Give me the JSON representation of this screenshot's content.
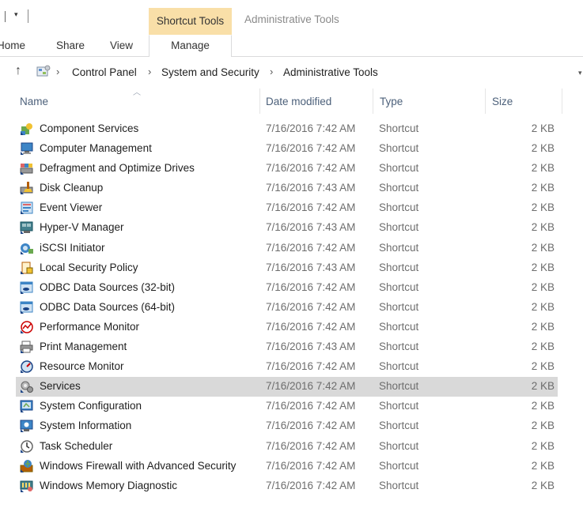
{
  "ribbon": {
    "context_tab_label": "Shortcut Tools",
    "window_title": "Administrative Tools",
    "tabs": [
      {
        "label": "Home"
      },
      {
        "label": "Share"
      },
      {
        "label": "View"
      }
    ],
    "manage_label": "Manage",
    "context_color": "#f9dfa8"
  },
  "address": {
    "crumbs": [
      "Control Panel",
      "System and Security",
      "Administrative Tools"
    ]
  },
  "columns": {
    "name": "Name",
    "date": "Date modified",
    "type": "Type",
    "size": "Size"
  },
  "files": [
    {
      "name": "Component Services",
      "date": "7/16/2016 7:42 AM",
      "type": "Shortcut",
      "size": "2 KB",
      "icon": "component-services-icon"
    },
    {
      "name": "Computer Management",
      "date": "7/16/2016 7:42 AM",
      "type": "Shortcut",
      "size": "2 KB",
      "icon": "computer-management-icon"
    },
    {
      "name": "Defragment and Optimize Drives",
      "date": "7/16/2016 7:42 AM",
      "type": "Shortcut",
      "size": "2 KB",
      "icon": "defragment-icon"
    },
    {
      "name": "Disk Cleanup",
      "date": "7/16/2016 7:43 AM",
      "type": "Shortcut",
      "size": "2 KB",
      "icon": "disk-cleanup-icon"
    },
    {
      "name": "Event Viewer",
      "date": "7/16/2016 7:42 AM",
      "type": "Shortcut",
      "size": "2 KB",
      "icon": "event-viewer-icon"
    },
    {
      "name": "Hyper-V Manager",
      "date": "7/16/2016 7:43 AM",
      "type": "Shortcut",
      "size": "2 KB",
      "icon": "hyper-v-icon"
    },
    {
      "name": "iSCSI Initiator",
      "date": "7/16/2016 7:42 AM",
      "type": "Shortcut",
      "size": "2 KB",
      "icon": "iscsi-icon"
    },
    {
      "name": "Local Security Policy",
      "date": "7/16/2016 7:43 AM",
      "type": "Shortcut",
      "size": "2 KB",
      "icon": "security-policy-icon"
    },
    {
      "name": "ODBC Data Sources (32-bit)",
      "date": "7/16/2016 7:42 AM",
      "type": "Shortcut",
      "size": "2 KB",
      "icon": "odbc-icon"
    },
    {
      "name": "ODBC Data Sources (64-bit)",
      "date": "7/16/2016 7:42 AM",
      "type": "Shortcut",
      "size": "2 KB",
      "icon": "odbc-icon"
    },
    {
      "name": "Performance Monitor",
      "date": "7/16/2016 7:42 AM",
      "type": "Shortcut",
      "size": "2 KB",
      "icon": "performance-monitor-icon"
    },
    {
      "name": "Print Management",
      "date": "7/16/2016 7:43 AM",
      "type": "Shortcut",
      "size": "2 KB",
      "icon": "print-management-icon"
    },
    {
      "name": "Resource Monitor",
      "date": "7/16/2016 7:42 AM",
      "type": "Shortcut",
      "size": "2 KB",
      "icon": "resource-monitor-icon"
    },
    {
      "name": "Services",
      "date": "7/16/2016 7:42 AM",
      "type": "Shortcut",
      "size": "2 KB",
      "icon": "services-icon",
      "selected": true
    },
    {
      "name": "System Configuration",
      "date": "7/16/2016 7:42 AM",
      "type": "Shortcut",
      "size": "2 KB",
      "icon": "system-configuration-icon"
    },
    {
      "name": "System Information",
      "date": "7/16/2016 7:42 AM",
      "type": "Shortcut",
      "size": "2 KB",
      "icon": "system-information-icon"
    },
    {
      "name": "Task Scheduler",
      "date": "7/16/2016 7:42 AM",
      "type": "Shortcut",
      "size": "2 KB",
      "icon": "task-scheduler-icon"
    },
    {
      "name": "Windows Firewall with Advanced Security",
      "date": "7/16/2016 7:42 AM",
      "type": "Shortcut",
      "size": "2 KB",
      "icon": "firewall-icon"
    },
    {
      "name": "Windows Memory Diagnostic",
      "date": "7/16/2016 7:42 AM",
      "type": "Shortcut",
      "size": "2 KB",
      "icon": "memory-diagnostic-icon"
    }
  ],
  "colors": {
    "selection": "#d9d9d9",
    "header_text": "#4c607a",
    "secondary_text": "#6d6d6d"
  }
}
